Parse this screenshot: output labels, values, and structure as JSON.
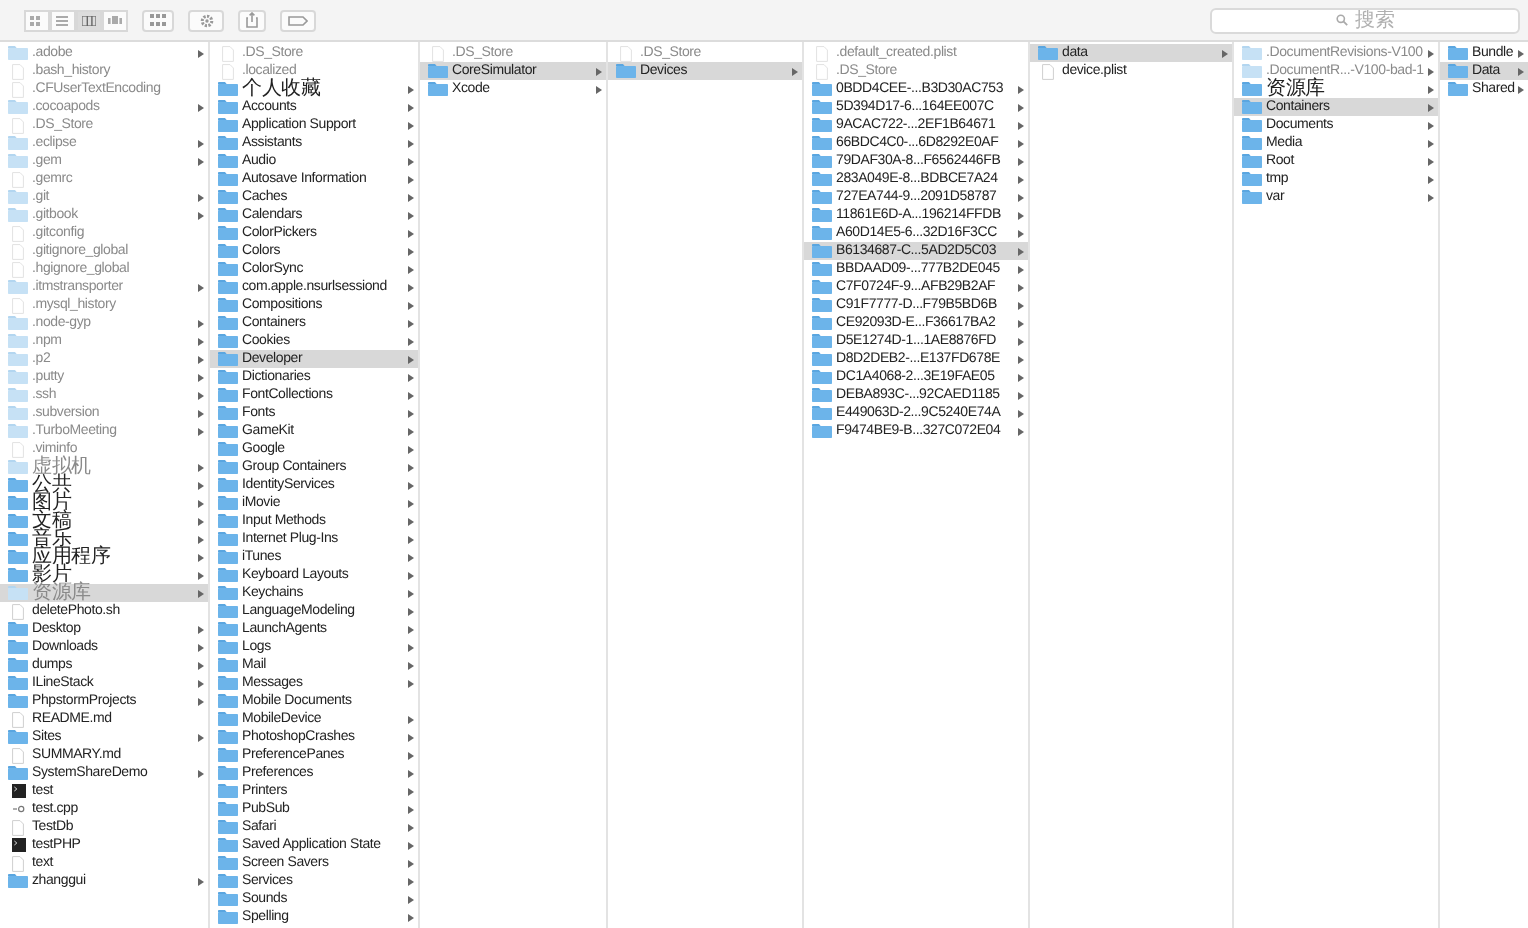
{
  "toolbar": {
    "view_modes": [
      {
        "kind": "icons",
        "selected": false
      },
      {
        "kind": "list",
        "selected": false
      },
      {
        "kind": "columns",
        "selected": true
      },
      {
        "kind": "coverflow",
        "selected": false
      }
    ]
  },
  "search": {
    "placeholder": "搜索"
  },
  "columns": [
    {
      "items": [
        {
          "name": ".adobe",
          "kind": "folder",
          "hidden": true,
          "expandable": true,
          "selected": false
        },
        {
          "name": ".bash_history",
          "kind": "file",
          "hidden": true,
          "expandable": false,
          "selected": false
        },
        {
          "name": ".CFUserTextEncoding",
          "kind": "file",
          "hidden": true,
          "expandable": false,
          "selected": false
        },
        {
          "name": ".cocoapods",
          "kind": "folder",
          "hidden": true,
          "expandable": true,
          "selected": false
        },
        {
          "name": ".DS_Store",
          "kind": "file",
          "hidden": true,
          "expandable": false,
          "selected": false
        },
        {
          "name": ".eclipse",
          "kind": "folder",
          "hidden": true,
          "expandable": true,
          "selected": false
        },
        {
          "name": ".gem",
          "kind": "folder",
          "hidden": true,
          "expandable": true,
          "selected": false
        },
        {
          "name": ".gemrc",
          "kind": "file",
          "hidden": true,
          "expandable": false,
          "selected": false
        },
        {
          "name": ".git",
          "kind": "folder",
          "hidden": true,
          "expandable": true,
          "selected": false
        },
        {
          "name": ".gitbook",
          "kind": "folder",
          "hidden": true,
          "expandable": true,
          "selected": false
        },
        {
          "name": ".gitconfig",
          "kind": "file",
          "hidden": true,
          "expandable": false,
          "selected": false
        },
        {
          "name": ".gitignore_global",
          "kind": "file",
          "hidden": true,
          "expandable": false,
          "selected": false
        },
        {
          "name": ".hgignore_global",
          "kind": "file",
          "hidden": true,
          "expandable": false,
          "selected": false
        },
        {
          "name": ".itmstransporter",
          "kind": "folder",
          "hidden": true,
          "expandable": true,
          "selected": false
        },
        {
          "name": ".mysql_history",
          "kind": "file",
          "hidden": true,
          "expandable": false,
          "selected": false
        },
        {
          "name": ".node-gyp",
          "kind": "folder",
          "hidden": true,
          "expandable": true,
          "selected": false
        },
        {
          "name": ".npm",
          "kind": "folder",
          "hidden": true,
          "expandable": true,
          "selected": false
        },
        {
          "name": ".p2",
          "kind": "folder",
          "hidden": true,
          "expandable": true,
          "selected": false
        },
        {
          "name": ".putty",
          "kind": "folder",
          "hidden": true,
          "expandable": true,
          "selected": false
        },
        {
          "name": ".ssh",
          "kind": "folder",
          "hidden": true,
          "expandable": true,
          "selected": false
        },
        {
          "name": ".subversion",
          "kind": "folder",
          "hidden": true,
          "expandable": true,
          "selected": false
        },
        {
          "name": ".TurboMeeting",
          "kind": "folder",
          "hidden": true,
          "expandable": true,
          "selected": false
        },
        {
          "name": ".viminfo",
          "kind": "file",
          "hidden": true,
          "expandable": false,
          "selected": false
        },
        {
          "name": "虚拟机",
          "kind": "folder",
          "hidden": true,
          "expandable": true,
          "selected": false
        },
        {
          "name": "公共",
          "kind": "folder",
          "hidden": false,
          "expandable": true,
          "selected": false
        },
        {
          "name": "图片",
          "kind": "folder",
          "hidden": false,
          "expandable": true,
          "selected": false
        },
        {
          "name": "文稿",
          "kind": "folder",
          "hidden": false,
          "expandable": true,
          "selected": false
        },
        {
          "name": "音乐",
          "kind": "folder",
          "hidden": false,
          "expandable": true,
          "selected": false
        },
        {
          "name": "应用程序",
          "kind": "folder",
          "hidden": false,
          "expandable": true,
          "selected": false
        },
        {
          "name": "影片",
          "kind": "folder",
          "hidden": false,
          "expandable": true,
          "selected": false
        },
        {
          "name": "资源库",
          "kind": "folder",
          "hidden": true,
          "expandable": true,
          "selected": true
        },
        {
          "name": "deletePhoto.sh",
          "kind": "file",
          "hidden": false,
          "expandable": false,
          "selected": false
        },
        {
          "name": "Desktop",
          "kind": "folder",
          "hidden": false,
          "expandable": true,
          "selected": false
        },
        {
          "name": "Downloads",
          "kind": "folder",
          "hidden": false,
          "expandable": true,
          "selected": false
        },
        {
          "name": "dumps",
          "kind": "folder",
          "hidden": false,
          "expandable": true,
          "selected": false
        },
        {
          "name": "ILineStack",
          "kind": "folder",
          "hidden": false,
          "expandable": true,
          "selected": false
        },
        {
          "name": "PhpstormProjects",
          "kind": "folder",
          "hidden": false,
          "expandable": true,
          "selected": false
        },
        {
          "name": "README.md",
          "kind": "file",
          "hidden": false,
          "expandable": false,
          "selected": false
        },
        {
          "name": "Sites",
          "kind": "folder",
          "hidden": false,
          "expandable": true,
          "selected": false
        },
        {
          "name": "SUMMARY.md",
          "kind": "file",
          "hidden": false,
          "expandable": false,
          "selected": false
        },
        {
          "name": "SystemShareDemo",
          "kind": "folder",
          "hidden": false,
          "expandable": true,
          "selected": false
        },
        {
          "name": "test",
          "kind": "executable",
          "hidden": false,
          "expandable": false,
          "selected": false
        },
        {
          "name": "test.cpp",
          "kind": "source",
          "hidden": false,
          "expandable": false,
          "selected": false
        },
        {
          "name": "TestDb",
          "kind": "file",
          "hidden": false,
          "expandable": false,
          "selected": false
        },
        {
          "name": "testPHP",
          "kind": "executable",
          "hidden": false,
          "expandable": false,
          "selected": false
        },
        {
          "name": "text",
          "kind": "file",
          "hidden": false,
          "expandable": false,
          "selected": false
        },
        {
          "name": "zhanggui",
          "kind": "folder",
          "hidden": false,
          "expandable": true,
          "selected": false
        }
      ]
    },
    {
      "items": [
        {
          "name": ".DS_Store",
          "kind": "file",
          "hidden": true,
          "expandable": false,
          "selected": false
        },
        {
          "name": ".localized",
          "kind": "file",
          "hidden": true,
          "expandable": false,
          "selected": false
        },
        {
          "name": "个人收藏",
          "kind": "folder",
          "hidden": false,
          "expandable": true,
          "selected": false
        },
        {
          "name": "Accounts",
          "kind": "folder",
          "hidden": false,
          "expandable": true,
          "selected": false
        },
        {
          "name": "Application Support",
          "kind": "folder",
          "hidden": false,
          "expandable": true,
          "selected": false
        },
        {
          "name": "Assistants",
          "kind": "folder",
          "hidden": false,
          "expandable": true,
          "selected": false
        },
        {
          "name": "Audio",
          "kind": "folder",
          "hidden": false,
          "expandable": true,
          "selected": false
        },
        {
          "name": "Autosave Information",
          "kind": "folder",
          "hidden": false,
          "expandable": true,
          "selected": false
        },
        {
          "name": "Caches",
          "kind": "folder",
          "hidden": false,
          "expandable": true,
          "selected": false
        },
        {
          "name": "Calendars",
          "kind": "folder",
          "hidden": false,
          "expandable": true,
          "selected": false
        },
        {
          "name": "ColorPickers",
          "kind": "folder",
          "hidden": false,
          "expandable": true,
          "selected": false
        },
        {
          "name": "Colors",
          "kind": "folder",
          "hidden": false,
          "expandable": true,
          "selected": false
        },
        {
          "name": "ColorSync",
          "kind": "folder",
          "hidden": false,
          "expandable": true,
          "selected": false
        },
        {
          "name": "com.apple.nsurlsessiond",
          "kind": "folder",
          "hidden": false,
          "expandable": true,
          "selected": false
        },
        {
          "name": "Compositions",
          "kind": "folder",
          "hidden": false,
          "expandable": true,
          "selected": false
        },
        {
          "name": "Containers",
          "kind": "folder",
          "hidden": false,
          "expandable": true,
          "selected": false
        },
        {
          "name": "Cookies",
          "kind": "folder",
          "hidden": false,
          "expandable": true,
          "selected": false
        },
        {
          "name": "Developer",
          "kind": "folder",
          "hidden": false,
          "expandable": true,
          "selected": true
        },
        {
          "name": "Dictionaries",
          "kind": "folder",
          "hidden": false,
          "expandable": true,
          "selected": false
        },
        {
          "name": "FontCollections",
          "kind": "folder",
          "hidden": false,
          "expandable": true,
          "selected": false
        },
        {
          "name": "Fonts",
          "kind": "folder",
          "hidden": false,
          "expandable": true,
          "selected": false
        },
        {
          "name": "GameKit",
          "kind": "folder",
          "hidden": false,
          "expandable": true,
          "selected": false
        },
        {
          "name": "Google",
          "kind": "folder",
          "hidden": false,
          "expandable": true,
          "selected": false
        },
        {
          "name": "Group Containers",
          "kind": "folder",
          "hidden": false,
          "expandable": true,
          "selected": false
        },
        {
          "name": "IdentityServices",
          "kind": "folder",
          "hidden": false,
          "expandable": true,
          "selected": false
        },
        {
          "name": "iMovie",
          "kind": "folder",
          "hidden": false,
          "expandable": true,
          "selected": false
        },
        {
          "name": "Input Methods",
          "kind": "folder",
          "hidden": false,
          "expandable": true,
          "selected": false
        },
        {
          "name": "Internet Plug-Ins",
          "kind": "folder",
          "hidden": false,
          "expandable": true,
          "selected": false
        },
        {
          "name": "iTunes",
          "kind": "folder",
          "hidden": false,
          "expandable": true,
          "selected": false
        },
        {
          "name": "Keyboard Layouts",
          "kind": "folder",
          "hidden": false,
          "expandable": true,
          "selected": false
        },
        {
          "name": "Keychains",
          "kind": "folder",
          "hidden": false,
          "expandable": true,
          "selected": false
        },
        {
          "name": "LanguageModeling",
          "kind": "folder",
          "hidden": false,
          "expandable": true,
          "selected": false
        },
        {
          "name": "LaunchAgents",
          "kind": "folder",
          "hidden": false,
          "expandable": true,
          "selected": false
        },
        {
          "name": "Logs",
          "kind": "folder",
          "hidden": false,
          "expandable": true,
          "selected": false
        },
        {
          "name": "Mail",
          "kind": "folder",
          "hidden": false,
          "expandable": true,
          "selected": false
        },
        {
          "name": "Messages",
          "kind": "folder",
          "hidden": false,
          "expandable": true,
          "selected": false
        },
        {
          "name": "Mobile Documents",
          "kind": "folder",
          "hidden": false,
          "expandable": false,
          "selected": false
        },
        {
          "name": "MobileDevice",
          "kind": "folder",
          "hidden": false,
          "expandable": true,
          "selected": false
        },
        {
          "name": "PhotoshopCrashes",
          "kind": "folder",
          "hidden": false,
          "expandable": true,
          "selected": false
        },
        {
          "name": "PreferencePanes",
          "kind": "folder",
          "hidden": false,
          "expandable": true,
          "selected": false
        },
        {
          "name": "Preferences",
          "kind": "folder",
          "hidden": false,
          "expandable": true,
          "selected": false
        },
        {
          "name": "Printers",
          "kind": "folder",
          "hidden": false,
          "expandable": true,
          "selected": false
        },
        {
          "name": "PubSub",
          "kind": "folder",
          "hidden": false,
          "expandable": true,
          "selected": false
        },
        {
          "name": "Safari",
          "kind": "folder",
          "hidden": false,
          "expandable": true,
          "selected": false
        },
        {
          "name": "Saved Application State",
          "kind": "folder",
          "hidden": false,
          "expandable": true,
          "selected": false
        },
        {
          "name": "Screen Savers",
          "kind": "folder",
          "hidden": false,
          "expandable": true,
          "selected": false
        },
        {
          "name": "Services",
          "kind": "folder",
          "hidden": false,
          "expandable": true,
          "selected": false
        },
        {
          "name": "Sounds",
          "kind": "folder",
          "hidden": false,
          "expandable": true,
          "selected": false
        },
        {
          "name": "Spelling",
          "kind": "folder",
          "hidden": false,
          "expandable": true,
          "selected": false
        }
      ]
    },
    {
      "items": [
        {
          "name": ".DS_Store",
          "kind": "file",
          "hidden": true,
          "expandable": false,
          "selected": false
        },
        {
          "name": "CoreSimulator",
          "kind": "folder",
          "hidden": false,
          "expandable": true,
          "selected": true
        },
        {
          "name": "Xcode",
          "kind": "folder",
          "hidden": false,
          "expandable": true,
          "selected": false
        }
      ]
    },
    {
      "items": [
        {
          "name": ".DS_Store",
          "kind": "file",
          "hidden": true,
          "expandable": false,
          "selected": false
        },
        {
          "name": "Devices",
          "kind": "folder",
          "hidden": false,
          "expandable": true,
          "selected": true
        }
      ]
    },
    {
      "items": [
        {
          "name": ".default_created.plist",
          "kind": "file",
          "hidden": true,
          "expandable": false,
          "selected": false
        },
        {
          "name": ".DS_Store",
          "kind": "file",
          "hidden": true,
          "expandable": false,
          "selected": false
        },
        {
          "name": "0BDD4CEE-...B3D30AC753",
          "kind": "folder",
          "hidden": false,
          "expandable": true,
          "selected": false
        },
        {
          "name": "5D394D17-6...164EE007C",
          "kind": "folder",
          "hidden": false,
          "expandable": true,
          "selected": false
        },
        {
          "name": "9ACAC722-...2EF1B64671",
          "kind": "folder",
          "hidden": false,
          "expandable": true,
          "selected": false
        },
        {
          "name": "66BDC4C0-...6D8292E0AF",
          "kind": "folder",
          "hidden": false,
          "expandable": true,
          "selected": false
        },
        {
          "name": "79DAF30A-8...F6562446FB",
          "kind": "folder",
          "hidden": false,
          "expandable": true,
          "selected": false
        },
        {
          "name": "283A049E-8...BDBCE7A24",
          "kind": "folder",
          "hidden": false,
          "expandable": true,
          "selected": false
        },
        {
          "name": "727EA744-9...2091D58787",
          "kind": "folder",
          "hidden": false,
          "expandable": true,
          "selected": false
        },
        {
          "name": "11861E6D-A...196214FFDB",
          "kind": "folder",
          "hidden": false,
          "expandable": true,
          "selected": false
        },
        {
          "name": "A60D14E5-6...32D16F3CC",
          "kind": "folder",
          "hidden": false,
          "expandable": true,
          "selected": false
        },
        {
          "name": "B6134687-C...5AD2D5C03",
          "kind": "folder",
          "hidden": false,
          "expandable": true,
          "selected": true
        },
        {
          "name": "BBDAAD09-...777B2DE045",
          "kind": "folder",
          "hidden": false,
          "expandable": true,
          "selected": false
        },
        {
          "name": "C7F0724F-9...AFB29B2AF",
          "kind": "folder",
          "hidden": false,
          "expandable": true,
          "selected": false
        },
        {
          "name": "C91F7777-D...F79B5BD6B",
          "kind": "folder",
          "hidden": false,
          "expandable": true,
          "selected": false
        },
        {
          "name": "CE92093D-E...F36617BA2",
          "kind": "folder",
          "hidden": false,
          "expandable": true,
          "selected": false
        },
        {
          "name": "D5E1274D-1...1AE8876FD",
          "kind": "folder",
          "hidden": false,
          "expandable": true,
          "selected": false
        },
        {
          "name": "D8D2DEB2-...E137FD678E",
          "kind": "folder",
          "hidden": false,
          "expandable": true,
          "selected": false
        },
        {
          "name": "DC1A4068-2...3E19FAE05",
          "kind": "folder",
          "hidden": false,
          "expandable": true,
          "selected": false
        },
        {
          "name": "DEBA893C-...92CAED1185",
          "kind": "folder",
          "hidden": false,
          "expandable": true,
          "selected": false
        },
        {
          "name": "E449063D-2...9C5240E74A",
          "kind": "folder",
          "hidden": false,
          "expandable": true,
          "selected": false
        },
        {
          "name": "F9474BE9-B...327C072E04",
          "kind": "folder",
          "hidden": false,
          "expandable": true,
          "selected": false
        }
      ]
    },
    {
      "items": [
        {
          "name": "data",
          "kind": "folder",
          "hidden": false,
          "expandable": true,
          "selected": true
        },
        {
          "name": "device.plist",
          "kind": "file",
          "hidden": false,
          "expandable": false,
          "selected": false
        }
      ]
    },
    {
      "items": [
        {
          "name": ".DocumentRevisions-V100",
          "kind": "folder",
          "hidden": true,
          "expandable": true,
          "selected": false
        },
        {
          "name": ".DocumentR...-V100-bad-1",
          "kind": "folder",
          "hidden": true,
          "expandable": true,
          "selected": false
        },
        {
          "name": "资源库",
          "kind": "folder",
          "hidden": false,
          "expandable": true,
          "selected": false
        },
        {
          "name": "Containers",
          "kind": "folder",
          "hidden": false,
          "expandable": true,
          "selected": true
        },
        {
          "name": "Documents",
          "kind": "folder",
          "hidden": false,
          "expandable": true,
          "selected": false
        },
        {
          "name": "Media",
          "kind": "folder",
          "hidden": false,
          "expandable": true,
          "selected": false
        },
        {
          "name": "Root",
          "kind": "folder",
          "hidden": false,
          "expandable": true,
          "selected": false
        },
        {
          "name": "tmp",
          "kind": "folder",
          "hidden": false,
          "expandable": true,
          "selected": false
        },
        {
          "name": "var",
          "kind": "folder",
          "hidden": false,
          "expandable": true,
          "selected": false
        }
      ]
    },
    {
      "items": [
        {
          "name": "Bundle",
          "kind": "folder",
          "hidden": false,
          "expandable": true,
          "selected": false
        },
        {
          "name": "Data",
          "kind": "folder",
          "hidden": false,
          "expandable": true,
          "selected": true
        },
        {
          "name": "Shared",
          "kind": "folder",
          "hidden": false,
          "expandable": true,
          "selected": false
        }
      ]
    }
  ]
}
